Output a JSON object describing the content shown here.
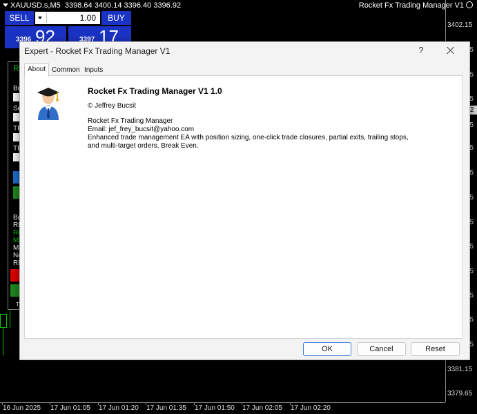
{
  "chart": {
    "symbol": "XAUUSD.s,M5",
    "ohlc": "3398.64 3400.14 3396.40 3396.92",
    "ea_name": "Rocket Fx Trading Manager V1",
    "price_labels": [
      "3402.15",
      ".65",
      ".15",
      ".65",
      ".92",
      ".15",
      ".65",
      ".15",
      ".65",
      ".15",
      ".65",
      ".15",
      ".65",
      "3381.15",
      "3379.65"
    ],
    "current_price_tag": ".92",
    "time_labels": [
      "16 Jun 2025",
      "17 Jun 01:05",
      "17 Jun 01:20",
      "17 Jun 01:35",
      "17 Jun 01:50",
      "17 Jun 02:05",
      "17 Jun 02:20"
    ]
  },
  "one_click": {
    "sell_label": "SELL",
    "buy_label": "BUY",
    "volume": "1.00",
    "bid_small": "3396",
    "bid_big": "92",
    "ask_small": "3397",
    "ask_big": "17"
  },
  "ea_panel": {
    "labels": [
      "R",
      "Bu",
      "Se",
      "TF",
      "TF",
      "Ba",
      "RI",
      "Ro",
      "Ma",
      "Ma",
      "Ne",
      "RI",
      "T"
    ]
  },
  "dialog": {
    "title": "Expert - Rocket Fx Trading Manager V1",
    "help": "?",
    "tabs": [
      {
        "label": "About"
      },
      {
        "label": "Common"
      },
      {
        "label": "Inputs"
      }
    ],
    "about": {
      "program_name": "Rocket Fx Trading Manager V1 1.0",
      "copyright": "© Jeffrey Bucsit",
      "description_lines": [
        "Rocket Fx Trading Manager",
        "Email: jef_frey_bucsit@yahoo.com",
        "Enhanced trade management EA with position sizing, one-click trade closures, partial exits, trailing stops,",
        "and multi-target orders, Break Even."
      ]
    },
    "buttons": {
      "ok": "OK",
      "cancel": "Cancel",
      "reset": "Reset"
    }
  }
}
